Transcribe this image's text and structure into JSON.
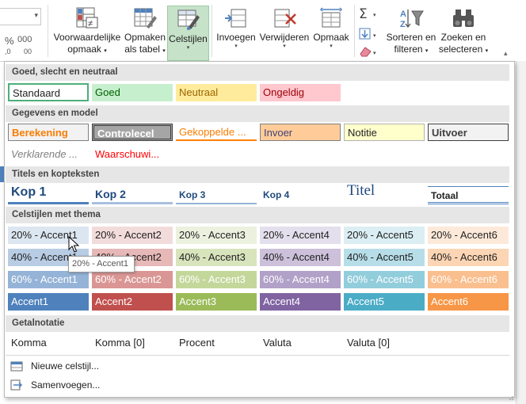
{
  "ribbon": {
    "buttons": [
      {
        "label1": "Voorwaardelijke",
        "label2": "opmaak",
        "icon": "conditional-formatting-icon"
      },
      {
        "label1": "Opmaken",
        "label2": "als tabel",
        "icon": "format-as-table-icon"
      },
      {
        "label1": "Celstijlen",
        "label2": "",
        "icon": "cell-styles-icon"
      },
      {
        "label1": "Invoegen",
        "label2": "",
        "icon": "insert-cells-icon"
      },
      {
        "label1": "Verwijderen",
        "label2": "",
        "icon": "delete-cells-icon"
      },
      {
        "label1": "Opmaak",
        "label2": "",
        "icon": "format-cells-icon"
      },
      {
        "label1": "Sorteren en",
        "label2": "filteren",
        "icon": "sort-filter-icon"
      },
      {
        "label1": "Zoeken en",
        "label2": "selecteren",
        "icon": "find-select-icon"
      }
    ],
    "left_glyphs": [
      "%",
      "000",
      ",0",
      "00"
    ]
  },
  "sections": [
    {
      "title": "Goed, slecht en neutraal",
      "cells": [
        "Standaard",
        "Goed",
        "Neutraal",
        "Ongeldig"
      ]
    },
    {
      "title": "Gegevens en model",
      "cells": [
        "Berekening",
        "Controlecel",
        "Gekoppelde ...",
        "Invoer",
        "Notitie",
        "Uitvoer",
        "Verklarende ...",
        "Waarschuwi..."
      ]
    },
    {
      "title": "Titels en kopteksten",
      "cells": [
        "Kop 1",
        "Kop 2",
        "Kop 3",
        "Kop 4",
        "Titel",
        "Totaal"
      ]
    },
    {
      "title": "Celstijlen met thema",
      "rows": [
        [
          "20% - Accent1",
          "20% - Accent2",
          "20% - Accent3",
          "20% - Accent4",
          "20% - Accent5",
          "20% - Accent6"
        ],
        [
          "40% - Accent1",
          "40% - Accent2",
          "40% - Accent3",
          "40% - Accent4",
          "40% - Accent5",
          "40% - Accent6"
        ],
        [
          "60% - Accent1",
          "60% - Accent2",
          "60% - Accent3",
          "60% - Accent4",
          "60% - Accent5",
          "60% - Accent6"
        ],
        [
          "Accent1",
          "Accent2",
          "Accent3",
          "Accent4",
          "Accent5",
          "Accent6"
        ]
      ]
    },
    {
      "title": "Getalnotatie",
      "cells": [
        "Komma",
        "Komma [0]",
        "Procent",
        "Valuta",
        "Valuta [0]"
      ]
    }
  ],
  "menu": {
    "new_style": "Nieuwe celstijl...",
    "merge": "Samenvoegen..."
  },
  "tooltip": "20% - Accent1",
  "colors": {
    "accent_active": "#c6e2c9",
    "accent1": "#4f81bd",
    "accent2": "#c0504d",
    "accent3": "#9bbb59",
    "accent4": "#8064a2",
    "accent5": "#4bacc6",
    "accent6": "#f79646"
  }
}
